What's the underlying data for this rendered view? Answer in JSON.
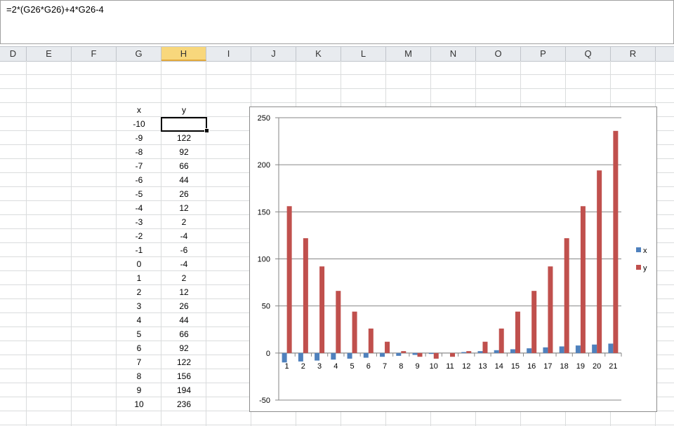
{
  "formula_bar": {
    "value": "=2*(G26*G26)+4*G26-4"
  },
  "columns": [
    {
      "label": "D",
      "w": 38
    },
    {
      "label": "E",
      "w": 64
    },
    {
      "label": "F",
      "w": 64
    },
    {
      "label": "G",
      "w": 64
    },
    {
      "label": "H",
      "w": 64,
      "selected": true
    },
    {
      "label": "I",
      "w": 64
    },
    {
      "label": "J",
      "w": 64
    },
    {
      "label": "K",
      "w": 64
    },
    {
      "label": "L",
      "w": 64
    },
    {
      "label": "M",
      "w": 64
    },
    {
      "label": "N",
      "w": 64
    },
    {
      "label": "O",
      "w": 64
    },
    {
      "label": "P",
      "w": 64
    },
    {
      "label": "Q",
      "w": 64
    },
    {
      "label": "R",
      "w": 64
    },
    {
      "label": "",
      "w": 30
    }
  ],
  "table": {
    "header_x": "x",
    "header_y": "y",
    "x": [
      "-10",
      "-9",
      "-8",
      "-7",
      "-6",
      "-5",
      "-4",
      "-3",
      "-2",
      "-1",
      "0",
      "1",
      "2",
      "3",
      "4",
      "5",
      "6",
      "7",
      "8",
      "9",
      "10"
    ],
    "y": [
      "156",
      "122",
      "92",
      "66",
      "44",
      "26",
      "12",
      "2",
      "-4",
      "-6",
      "-4",
      "2",
      "12",
      "26",
      "44",
      "66",
      "92",
      "122",
      "156",
      "194",
      "236"
    ]
  },
  "chart_data": {
    "type": "bar",
    "categories": [
      "1",
      "2",
      "3",
      "4",
      "5",
      "6",
      "7",
      "8",
      "9",
      "10",
      "11",
      "12",
      "13",
      "14",
      "15",
      "16",
      "17",
      "18",
      "19",
      "20",
      "21"
    ],
    "series": [
      {
        "name": "x",
        "color": "#4f81bd",
        "values": [
          -10,
          -9,
          -8,
          -7,
          -6,
          -5,
          -4,
          -3,
          -2,
          -1,
          0,
          1,
          2,
          3,
          4,
          5,
          6,
          7,
          8,
          9,
          10
        ]
      },
      {
        "name": "y",
        "color": "#c0504d",
        "values": [
          156,
          122,
          92,
          66,
          44,
          26,
          12,
          2,
          -4,
          -6,
          -4,
          2,
          12,
          26,
          44,
          66,
          92,
          122,
          156,
          194,
          236
        ]
      }
    ],
    "yticks": [
      "250",
      "200",
      "150",
      "100",
      "50",
      "0",
      "-50"
    ],
    "ylim": [
      -50,
      250
    ],
    "grid": true,
    "legend": "right"
  }
}
